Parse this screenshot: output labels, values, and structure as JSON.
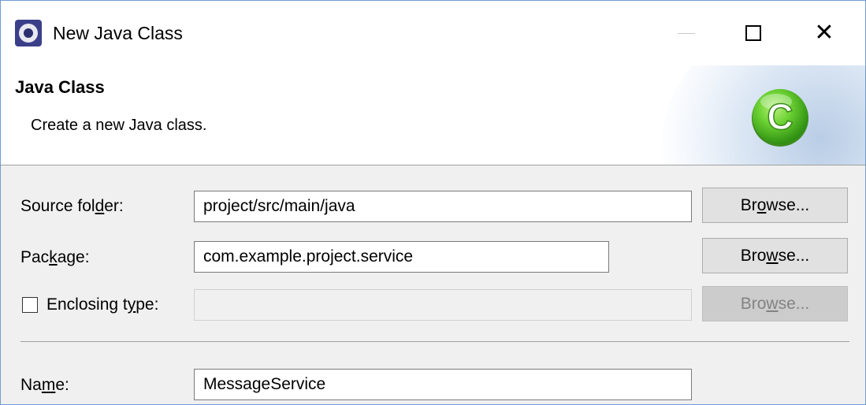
{
  "window": {
    "title": "New Java Class",
    "icon": "eclipse-icon",
    "controls": {
      "minimize": "minimize-icon",
      "maximize": "maximize-icon",
      "close": "close-icon",
      "close_glyph": "✕"
    }
  },
  "banner": {
    "title": "Java Class",
    "description": "Create a new Java class.",
    "icon": "java-class-icon",
    "icon_letter": "C",
    "icon_color": "#5fc72d"
  },
  "form": {
    "source_folder": {
      "label_pre": "Source fol",
      "label_mnemonic": "d",
      "label_post": "er:",
      "value": "project/src/main/java",
      "browse_pre": "Br",
      "browse_mnemonic": "o",
      "browse_post": "wse..."
    },
    "package": {
      "label_pre": "Pac",
      "label_mnemonic": "k",
      "label_post": "age:",
      "value": "com.example.project.service",
      "browse_pre": "Bro",
      "browse_mnemonic": "w",
      "browse_post": "se..."
    },
    "enclosing_type": {
      "checked": false,
      "label_pre": "Enclosing t",
      "label_mnemonic": "y",
      "label_post": "pe:",
      "value": "",
      "browse_pre": "Bro",
      "browse_mnemonic": "w",
      "browse_post": "se..."
    },
    "name": {
      "label_pre": "Na",
      "label_mnemonic": "m",
      "label_post": "e:",
      "value": "MessageService"
    }
  },
  "colors": {
    "window_border": "#6f9ccf",
    "dialog_bg": "#f0f0f0",
    "button_bg": "#e1e1e1",
    "disabled_button_bg": "#cccccc"
  }
}
